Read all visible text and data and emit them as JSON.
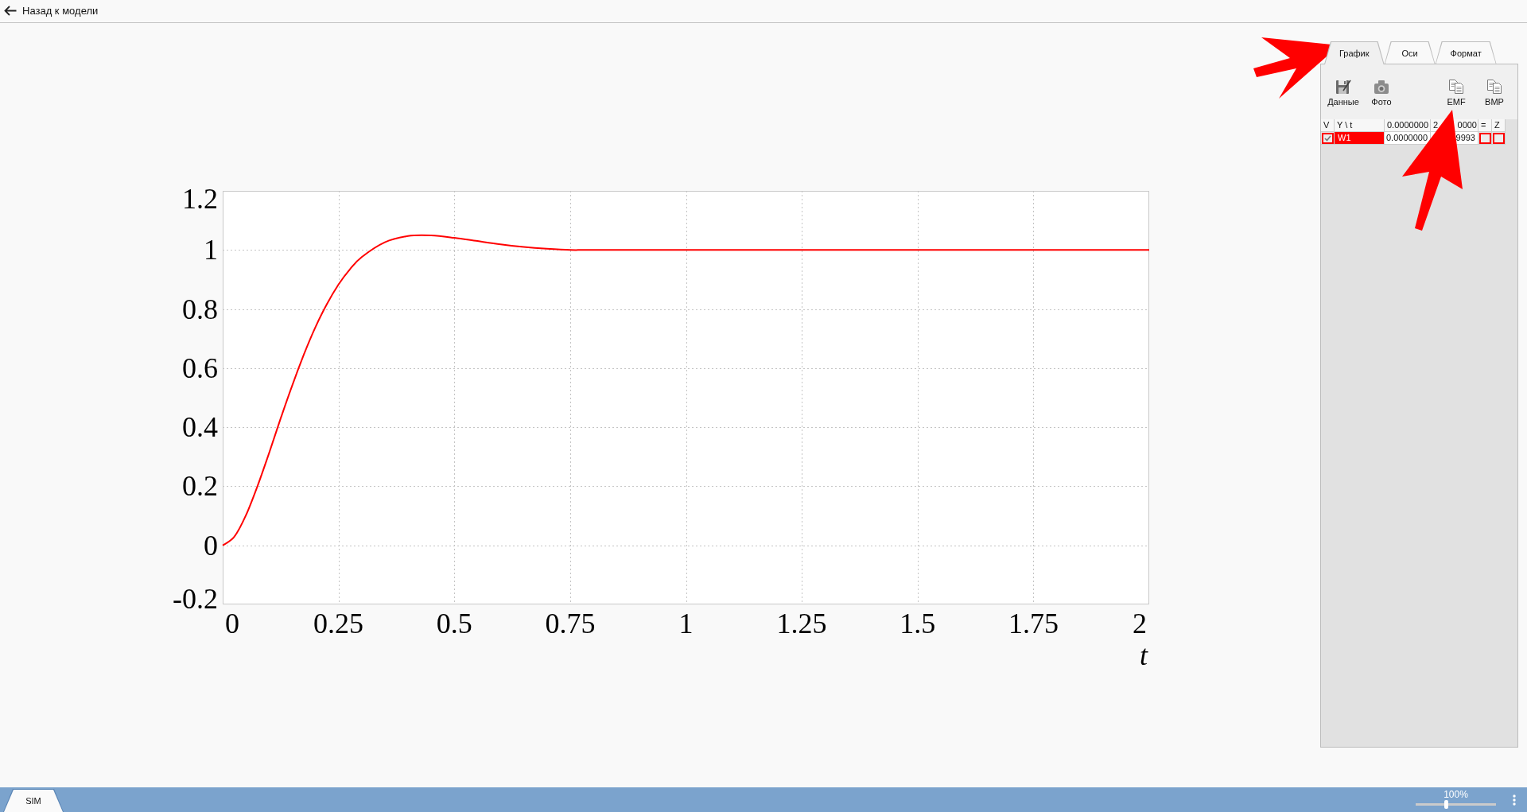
{
  "header": {
    "back_link": "Назад к модели"
  },
  "chart": {
    "chart_data": {
      "type": "line",
      "xlabel": "t",
      "x": [
        0,
        0.025,
        0.05,
        0.075,
        0.1,
        0.125,
        0.15,
        0.175,
        0.2,
        0.225,
        0.25,
        0.275,
        0.3,
        0.35,
        0.4,
        0.45,
        0.5,
        0.55,
        0.6,
        0.65,
        0.7,
        0.75,
        0.8,
        1,
        1.25,
        1.5,
        1.75,
        2
      ],
      "series": [
        {
          "color": "#ff0000",
          "values": [
            0,
            0.029,
            0.101,
            0.2,
            0.312,
            0.429,
            0.541,
            0.645,
            0.738,
            0.817,
            0.883,
            0.935,
            0.976,
            1.026,
            1.047,
            1.049,
            1.041,
            1.03,
            1.019,
            1.01,
            1.004,
            1,
            1,
            1,
            1,
            1,
            1,
            1
          ]
        }
      ],
      "xlim": [
        0,
        2
      ],
      "ylim": [
        -0.2,
        1.2
      ],
      "xticks": [
        0,
        0.25,
        0.5,
        0.75,
        1,
        1.25,
        1.5,
        1.75,
        2
      ],
      "yticks": [
        -0.2,
        0,
        0.2,
        0.4,
        0.6,
        0.8,
        1,
        1.2
      ],
      "grid": true
    }
  },
  "panel": {
    "tabs": [
      {
        "label": "График",
        "selected": true
      },
      {
        "label": "Оси",
        "selected": false
      },
      {
        "label": "Формат",
        "selected": false
      }
    ],
    "toolbar": [
      {
        "label": "Данные"
      },
      {
        "label": "Фото"
      },
      {
        "label": "EMF"
      },
      {
        "label": "BMP"
      }
    ],
    "table": {
      "columns": [
        {
          "label": "V"
        },
        {
          "label": "Y \\ t"
        },
        {
          "label": "0.0000000"
        },
        {
          "fragments": [
            "2",
            "0000"
          ]
        },
        {
          "label": "="
        },
        {
          "label": "Z"
        }
      ],
      "rows": [
        {
          "v_checked": true,
          "name": "W1",
          "color": "#ff0000",
          "values": [
            "0.0000000",
            "9993"
          ],
          "eq_checked": false,
          "z_checked": false
        }
      ]
    }
  },
  "status_bar": {
    "tabs": [
      {
        "label": "SIM",
        "selected": true
      }
    ],
    "zoom": {
      "reading": "100%",
      "level": 0.38
    }
  }
}
